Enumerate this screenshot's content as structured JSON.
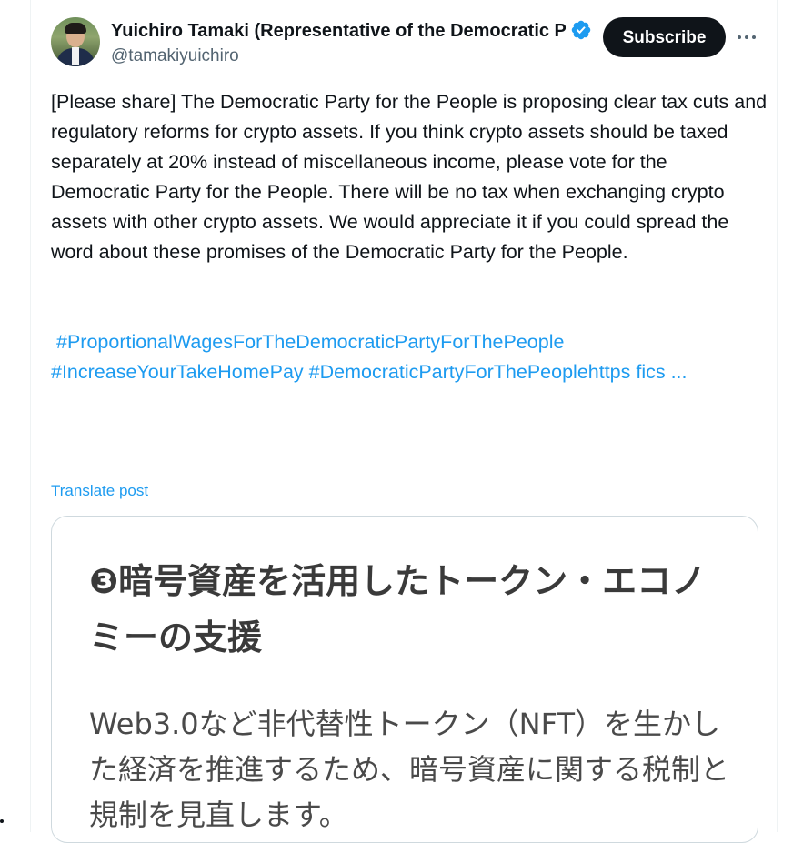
{
  "author": {
    "display_name": "Yuichiro Tamaki (Representative of the Democratic Party for the People)",
    "handle": "@tamakiyuichiro",
    "verified_color": "#1d9bf0"
  },
  "actions": {
    "subscribe_label": "Subscribe",
    "more_icon": "more-horizontal-icon"
  },
  "post": {
    "text": "[Please share] The Democratic Party for the People is proposing clear tax cuts and regulatory reforms for crypto assets. If you think crypto assets should be taxed separately at 20% instead of miscellaneous income, please vote for the Democratic Party for the People. There will be no tax when exchanging crypto assets with other crypto assets. We would appreciate it if you could spread the word about these promises of the Democratic Party for the People.",
    "hashtags": [
      "#ProportionalWagesForTheDemocraticPartyForThePeople",
      "#IncreaseYourTakeHomePay",
      "#DemocraticPartyForThePeoplehttps  fics ..."
    ],
    "translate_label": "Translate post"
  },
  "media": {
    "heading": "❸暗号資産を活用したトークン・エコノミーの支援",
    "body": "Web3.0など非代替性トークン（NFT）を生かした経済を推進するため、暗号資産に関する税制と規制を見直します。"
  },
  "colors": {
    "link": "#1d9bf0",
    "text": "#0f1419",
    "secondary": "#536471",
    "button_bg": "#0f1419"
  }
}
